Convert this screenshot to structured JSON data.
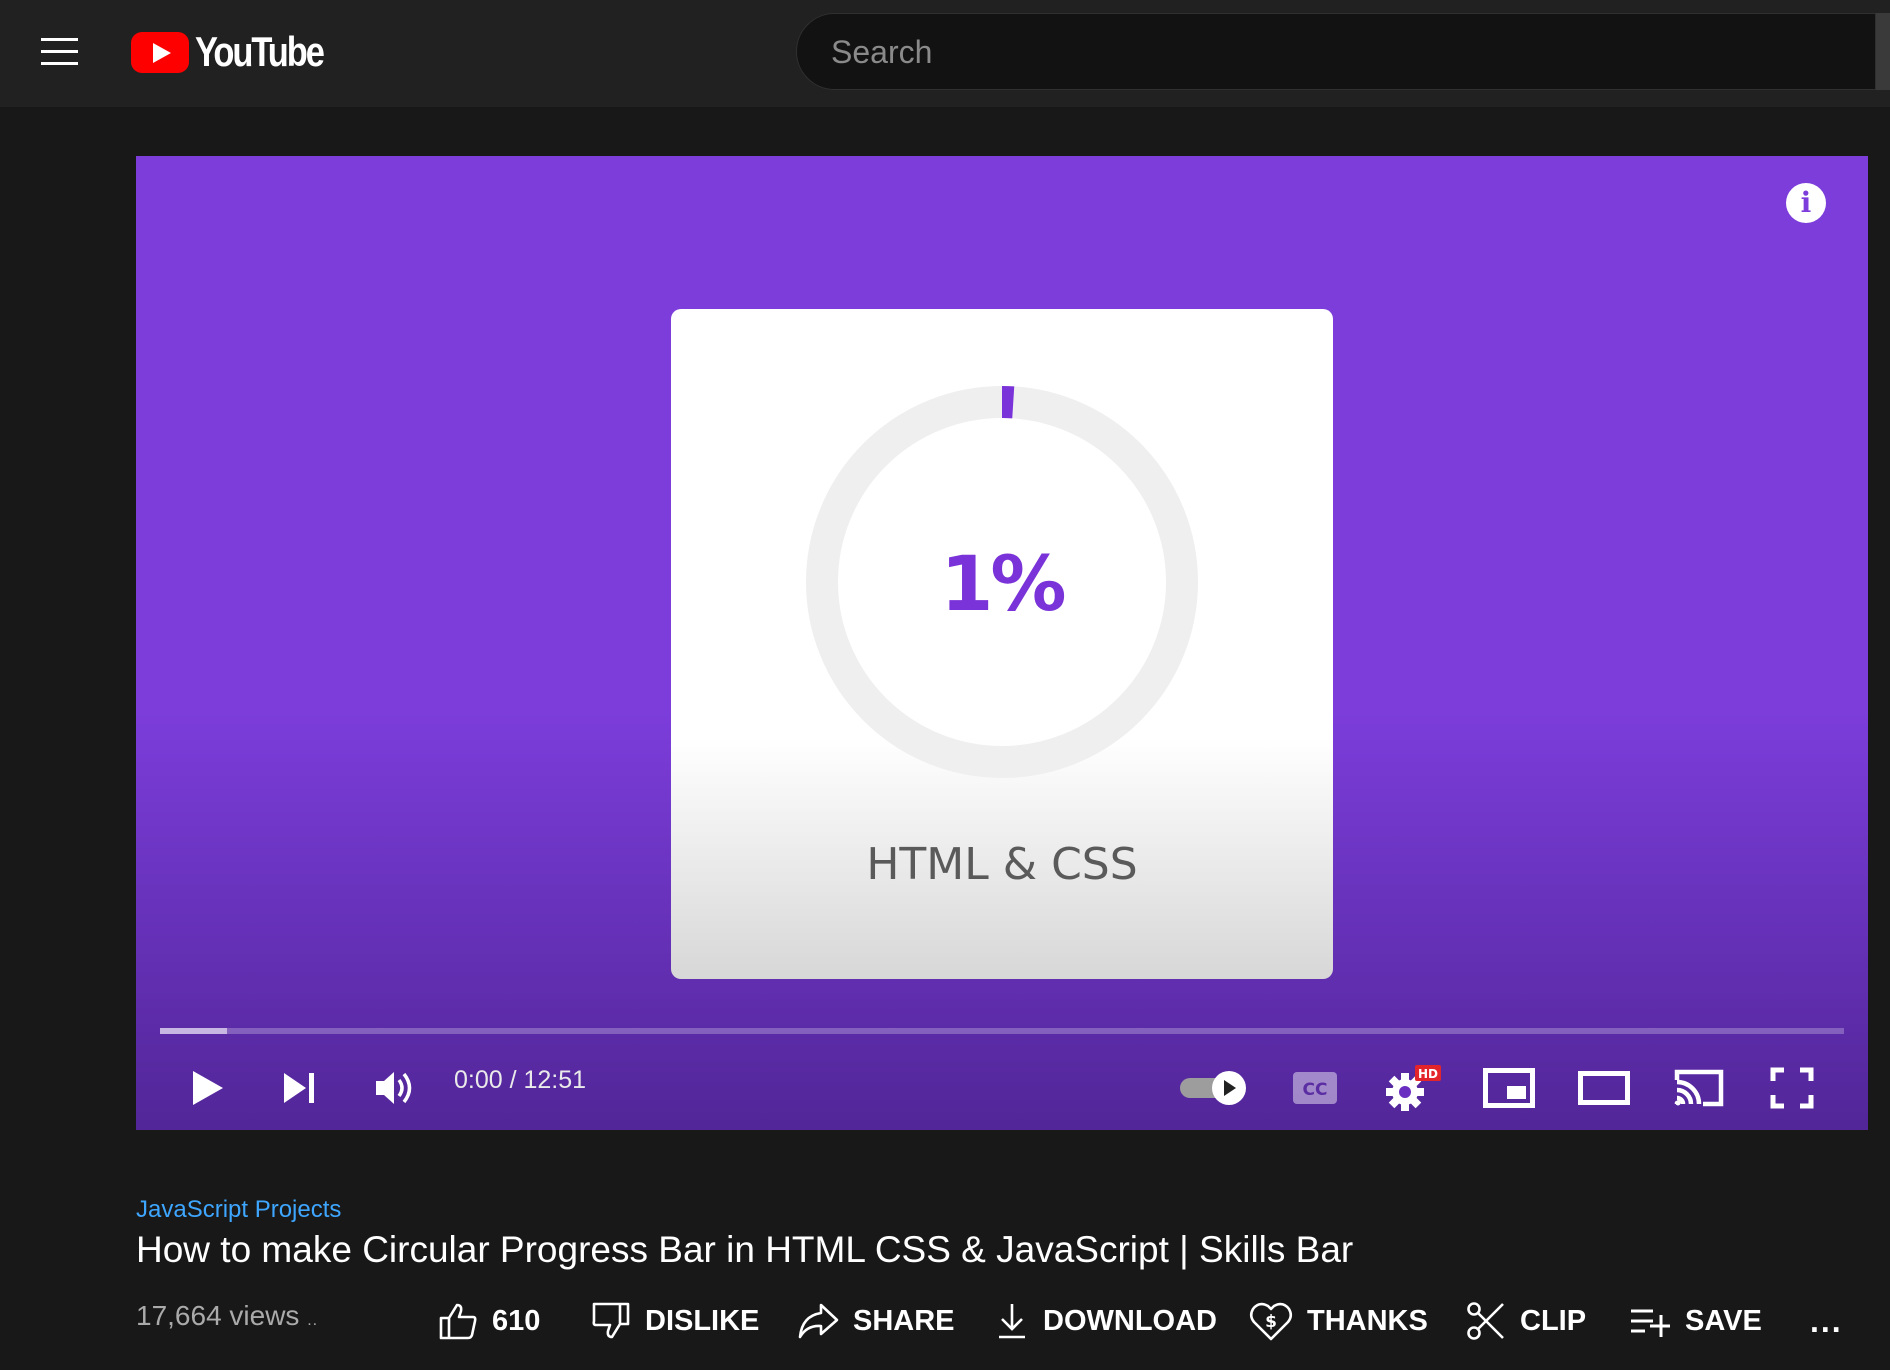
{
  "masthead": {
    "logo_text": "YouTube",
    "search_placeholder": "Search"
  },
  "player": {
    "background_color": "#7c3ddb",
    "content": {
      "progress_percent_label": "1%",
      "progress_value": 0.01,
      "skill_label": "HTML & CSS",
      "accent_color": "#7a33d8"
    },
    "controls": {
      "current_time": "0:00",
      "duration": "12:51",
      "time_label": "0:00 / 12:51",
      "played_fraction": 0.04,
      "quality_badge": "HD",
      "captions_label": "CC",
      "autoplay": "on",
      "icons": [
        "play-icon",
        "next-icon",
        "volume-icon",
        "autoplay-toggle",
        "captions-icon",
        "settings-icon",
        "miniplayer-icon",
        "theater-icon",
        "cast-icon",
        "fullscreen-icon"
      ]
    }
  },
  "video": {
    "channel": "JavaScript Projects",
    "title": "How to make Circular Progress Bar in HTML CSS & JavaScript | Skills Bar",
    "views": "17,664 views",
    "views_suffix": "..",
    "actions": {
      "like_count": "610",
      "dislike": "DISLIKE",
      "share": "SHARE",
      "download": "DOWNLOAD",
      "thanks": "THANKS",
      "clip": "CLIP",
      "save": "SAVE",
      "more": "..."
    }
  }
}
